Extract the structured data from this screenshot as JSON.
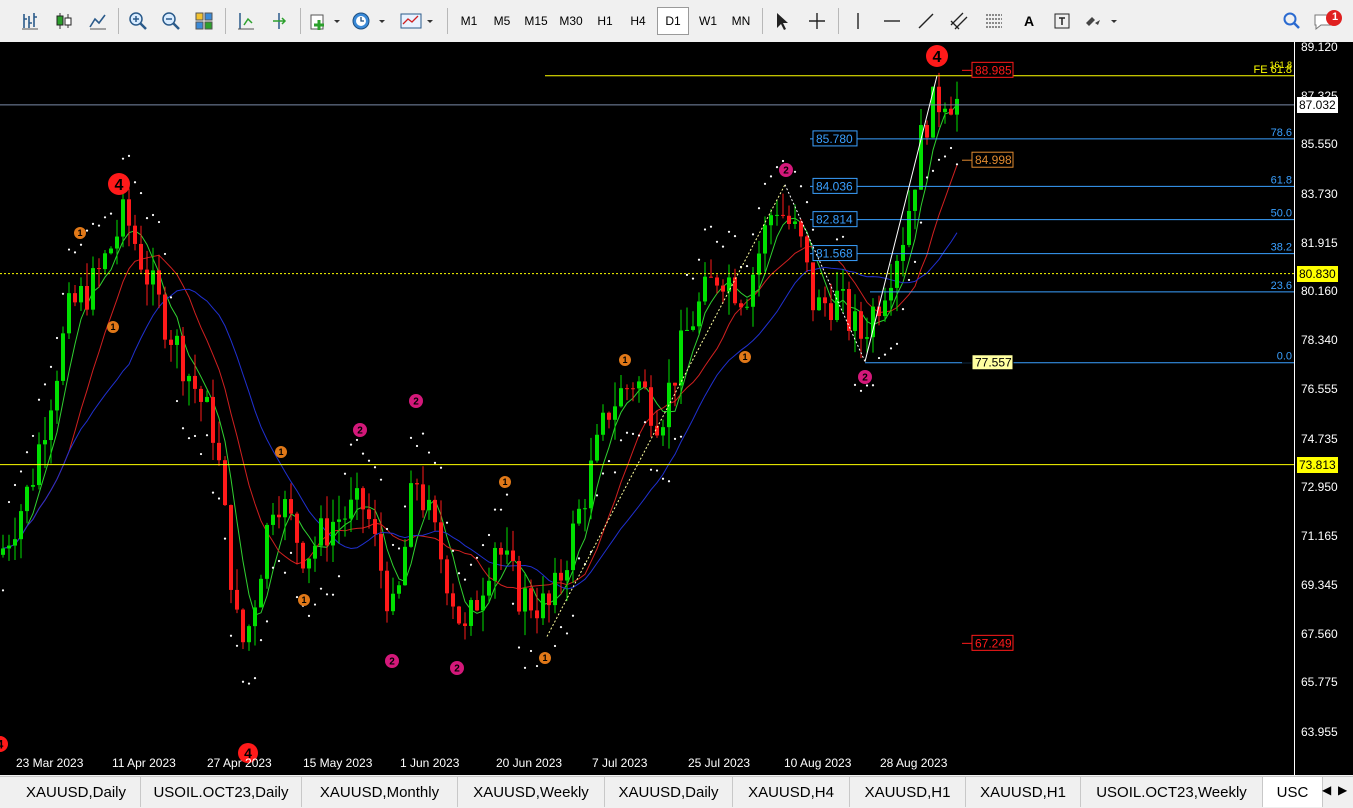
{
  "toolbar": {
    "timeframes": [
      "M1",
      "M5",
      "M15",
      "M30",
      "H1",
      "H4",
      "D1",
      "W1",
      "MN"
    ],
    "active_timeframe": "D1",
    "notification_count": "1",
    "text_tool": "A"
  },
  "price_axis": {
    "ticks": [
      "89.120",
      "87.325",
      "85.550",
      "83.730",
      "81.915",
      "80.160",
      "78.340",
      "76.555",
      "74.735",
      "72.950",
      "71.165",
      "69.345",
      "67.560",
      "65.775",
      "63.955"
    ],
    "current_price": "87.032",
    "line_80830": "80.830",
    "line_73813": "73.813"
  },
  "date_axis": [
    "23 Mar 2023",
    "11 Apr 2023",
    "27 Apr 2023",
    "15 May 2023",
    "1 Jun 2023",
    "20 Jun 2023",
    "7 Jul 2023",
    "25 Jul 2023",
    "10 Aug 2023",
    "28 Aug 2023"
  ],
  "fibonacci": {
    "levels": [
      "78.6",
      "61.8",
      "50.0",
      "38.2",
      "23.6",
      "0.0"
    ],
    "price_labels": [
      "85.780",
      "84.036",
      "82.814",
      "81.568"
    ],
    "fe_label": "FE 61.8",
    "fe_top": "161.8"
  },
  "markers": {
    "target_88": "88.985",
    "target_84": "84.998",
    "low_price": "77.557",
    "target_67": "67.249"
  },
  "wave_labels": {
    "four": "4",
    "two": "2",
    "one": "1"
  },
  "tabs": [
    "XAUUSD,Daily",
    "USOIL.OCT23,Daily",
    "XAUUSD,Monthly",
    "XAUUSD,Weekly",
    "XAUUSD,Daily",
    "XAUUSD,H4",
    "XAUUSD,H1",
    "XAUUSD,H1",
    "USOIL.OCT23,Weekly",
    "USC"
  ],
  "active_tab": "USC",
  "colors": {
    "bull": "#00e000",
    "bear": "#ff1a1a",
    "fib": "#3aa0ff",
    "yellow": "#ffff00",
    "wave_red": "#ff1a1a",
    "wave_magenta": "#d4187a",
    "wave_orange": "#e07818"
  }
}
